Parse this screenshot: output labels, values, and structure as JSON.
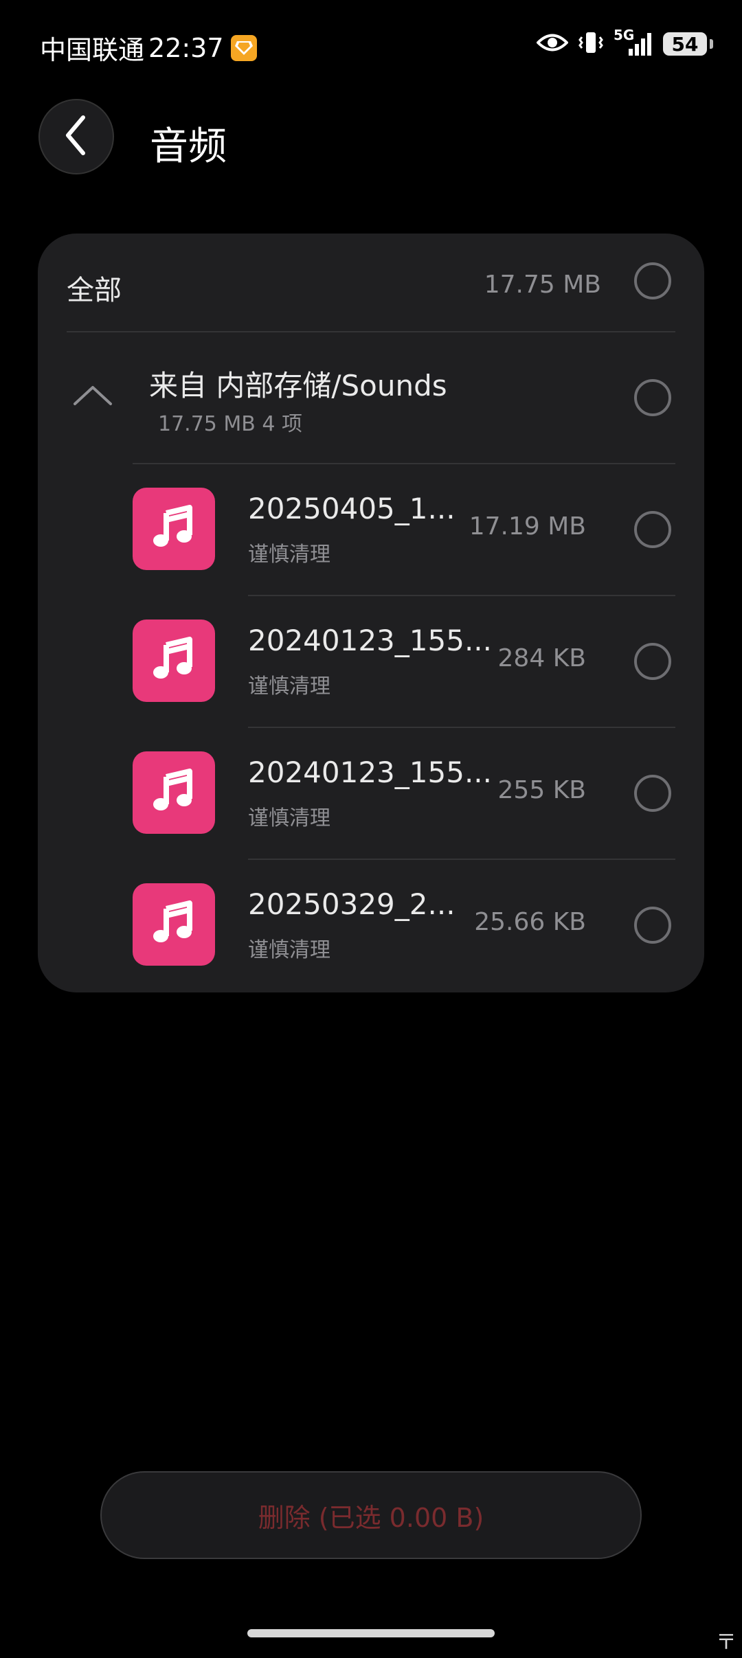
{
  "status_bar": {
    "carrier": "中国联通",
    "time": "22:37",
    "network": "5G",
    "battery": "54"
  },
  "header": {
    "title": "音频"
  },
  "select_all": {
    "label": "全部",
    "size": "17.75 MB"
  },
  "group": {
    "title": "来自 内部存储/Sounds",
    "summary": "17.75 MB 4 项"
  },
  "files": [
    {
      "name": "20250405_1...",
      "tag": "谨慎清理",
      "size": "17.19 MB"
    },
    {
      "name": "20240123_155...",
      "tag": "谨慎清理",
      "size": "284 KB"
    },
    {
      "name": "20240123_155...",
      "tag": "谨慎清理",
      "size": "255 KB"
    },
    {
      "name": "20250329_2...",
      "tag": "谨慎清理",
      "size": "25.66 KB"
    }
  ],
  "delete_button": {
    "label": "删除 (已选 0.00 B)"
  },
  "corner_glyph": "〒",
  "colors": {
    "background": "#000000",
    "card": "#1f1f21",
    "audio_icon": "#e8397a",
    "delete_text": "#7a2b2e"
  },
  "icons": {
    "back": "chevron-left-icon",
    "collapse": "chevron-up-icon",
    "file": "music-note-icon"
  }
}
